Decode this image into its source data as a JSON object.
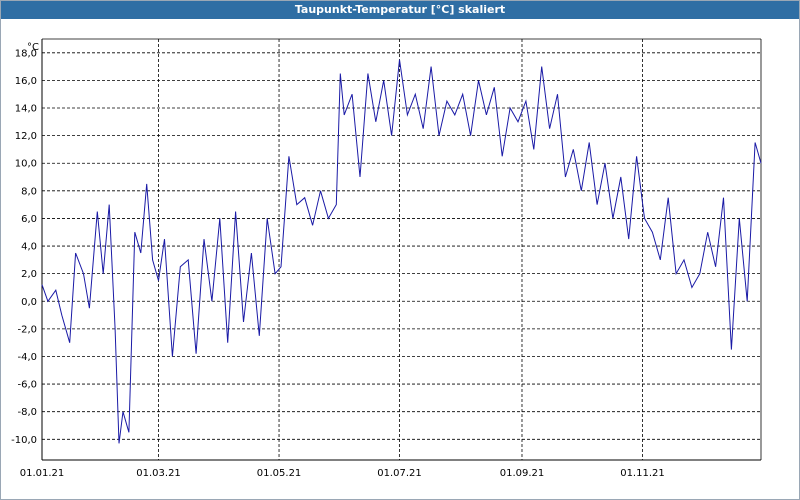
{
  "window": {
    "title": "Taupunkt-Temperatur [°C] skaliert"
  },
  "colors": {
    "titlebar": "#2f6ea4",
    "series": "#1a1aa6",
    "grid": "#000000",
    "background": "#ffffff"
  },
  "chart_data": {
    "type": "line",
    "title": "Taupunkt-Temperatur [°C] skaliert",
    "ylabel": "°C",
    "xlabel": "",
    "ylim": [
      -11.5,
      19
    ],
    "xlim": [
      "2021-01-01",
      "2021-12-31"
    ],
    "yticks": [
      -10,
      -8,
      -6,
      -4,
      -2,
      0,
      2,
      4,
      6,
      8,
      10,
      12,
      14,
      16,
      18
    ],
    "ytick_labels": [
      "-10,0",
      "-8,0",
      "-6,0",
      "-4,0",
      "-2,0",
      "0,0",
      "2,0",
      "4,0",
      "6,0",
      "8,0",
      "10,0",
      "12,0",
      "14,0",
      "16,0",
      "18,0"
    ],
    "xticks": [
      "2021-01-01",
      "2021-03-01",
      "2021-05-01",
      "2021-07-01",
      "2021-09-01",
      "2021-11-01"
    ],
    "xtick_labels": [
      "01.01.21",
      "01.03.21",
      "01.05.21",
      "01.07.21",
      "01.09.21",
      "01.11.21"
    ],
    "grid": true,
    "legend": "none",
    "series": [
      {
        "x": [
          "2021-01-01",
          "2021-01-04",
          "2021-01-08",
          "2021-01-11",
          "2021-01-15",
          "2021-01-18",
          "2021-01-22",
          "2021-01-25",
          "2021-01-29",
          "2021-02-01",
          "2021-02-04",
          "2021-02-07",
          "2021-02-09",
          "2021-02-11",
          "2021-02-14",
          "2021-02-17",
          "2021-02-20",
          "2021-02-23",
          "2021-02-26",
          "2021-03-01",
          "2021-03-04",
          "2021-03-08",
          "2021-03-12",
          "2021-03-16",
          "2021-03-20",
          "2021-03-24",
          "2021-03-28",
          "2021-04-01",
          "2021-04-05",
          "2021-04-09",
          "2021-04-13",
          "2021-04-17",
          "2021-04-21",
          "2021-04-25",
          "2021-04-29",
          "2021-05-02",
          "2021-05-06",
          "2021-05-10",
          "2021-05-14",
          "2021-05-18",
          "2021-05-22",
          "2021-05-26",
          "2021-05-30",
          "2021-06-01",
          "2021-06-03",
          "2021-06-07",
          "2021-06-11",
          "2021-06-15",
          "2021-06-19",
          "2021-06-23",
          "2021-06-27",
          "2021-07-01",
          "2021-07-05",
          "2021-07-09",
          "2021-07-13",
          "2021-07-17",
          "2021-07-21",
          "2021-07-25",
          "2021-07-29",
          "2021-08-02",
          "2021-08-06",
          "2021-08-10",
          "2021-08-14",
          "2021-08-18",
          "2021-08-22",
          "2021-08-26",
          "2021-08-30",
          "2021-09-03",
          "2021-09-07",
          "2021-09-11",
          "2021-09-15",
          "2021-09-19",
          "2021-09-23",
          "2021-09-27",
          "2021-10-01",
          "2021-10-05",
          "2021-10-09",
          "2021-10-13",
          "2021-10-17",
          "2021-10-21",
          "2021-10-25",
          "2021-10-29",
          "2021-11-02",
          "2021-11-06",
          "2021-11-10",
          "2021-11-14",
          "2021-11-18",
          "2021-11-22",
          "2021-11-26",
          "2021-11-30",
          "2021-12-04",
          "2021-12-08",
          "2021-12-12",
          "2021-12-16",
          "2021-12-20",
          "2021-12-24",
          "2021-12-28",
          "2021-12-31"
        ],
        "values": [
          1.2,
          0.0,
          0.8,
          -1.0,
          -3.0,
          3.5,
          2.0,
          -0.5,
          6.5,
          2.0,
          7.0,
          -2.0,
          -10.3,
          -8.0,
          -9.5,
          5.0,
          3.5,
          8.5,
          3.0,
          1.5,
          4.5,
          -4.0,
          2.5,
          3.0,
          -3.8,
          4.5,
          0.0,
          6.0,
          -3.0,
          6.5,
          -1.5,
          3.5,
          -2.5,
          6.0,
          2.0,
          2.5,
          10.5,
          7.0,
          7.5,
          5.5,
          8.0,
          6.0,
          7.0,
          16.5,
          13.5,
          15.0,
          9.0,
          16.5,
          13.0,
          16.0,
          12.0,
          17.5,
          13.5,
          15.0,
          12.5,
          17.0,
          12.0,
          14.5,
          13.5,
          15.0,
          12.0,
          16.0,
          13.5,
          15.5,
          10.5,
          14.0,
          13.0,
          14.5,
          11.0,
          17.0,
          12.5,
          15.0,
          9.0,
          11.0,
          8.0,
          11.5,
          7.0,
          10.0,
          6.0,
          9.0,
          4.5,
          10.5,
          6.0,
          5.0,
          3.0,
          7.5,
          2.0,
          3.0,
          1.0,
          2.0,
          5.0,
          2.5,
          7.5,
          -3.5,
          6.0,
          0.0,
          11.5,
          10.0
        ]
      }
    ]
  }
}
